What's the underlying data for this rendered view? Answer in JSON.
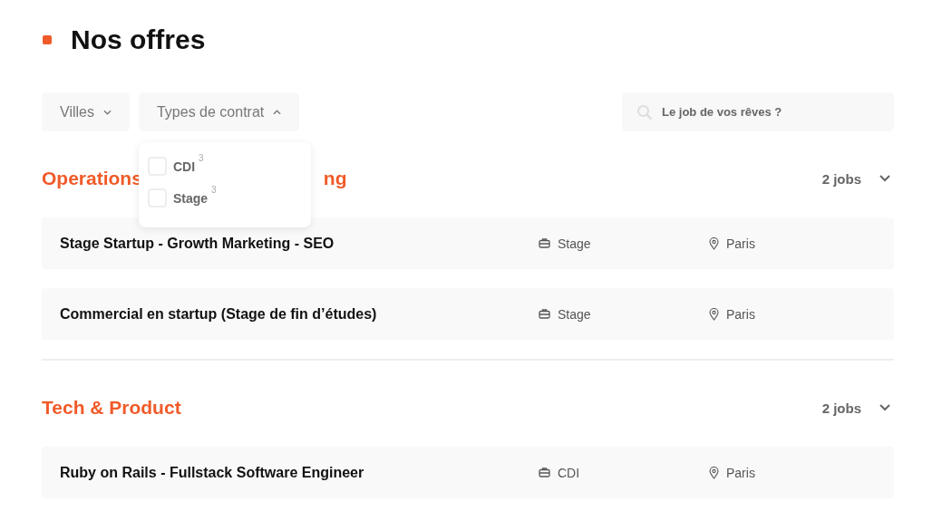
{
  "page_title": "Nos offres",
  "filters": [
    {
      "label": "Villes",
      "expanded": false
    },
    {
      "label": "Types de contrat",
      "expanded": true
    }
  ],
  "dropdown": {
    "options": [
      {
        "label": "CDI",
        "count": "3",
        "checked": false
      },
      {
        "label": "Stage",
        "count": "3",
        "checked": false
      }
    ]
  },
  "search": {
    "placeholder": "Le job de vos rêves ?"
  },
  "sections": [
    {
      "title_parts": [
        "Operations",
        "ng"
      ],
      "count": "2 jobs",
      "expanded": true,
      "jobs": [
        {
          "title": "Stage Startup - Growth Marketing - SEO",
          "contract": "Stage",
          "location": "Paris"
        },
        {
          "title": "Commercial en startup (Stage de fin d’études)",
          "contract": "Stage",
          "location": "Paris"
        }
      ]
    },
    {
      "title_parts": [
        "Tech & Product"
      ],
      "count": "2 jobs",
      "expanded": true,
      "jobs": [
        {
          "title": "Ruby on Rails - Fullstack Software Engineer",
          "contract": "CDI",
          "location": "Paris"
        }
      ]
    }
  ]
}
